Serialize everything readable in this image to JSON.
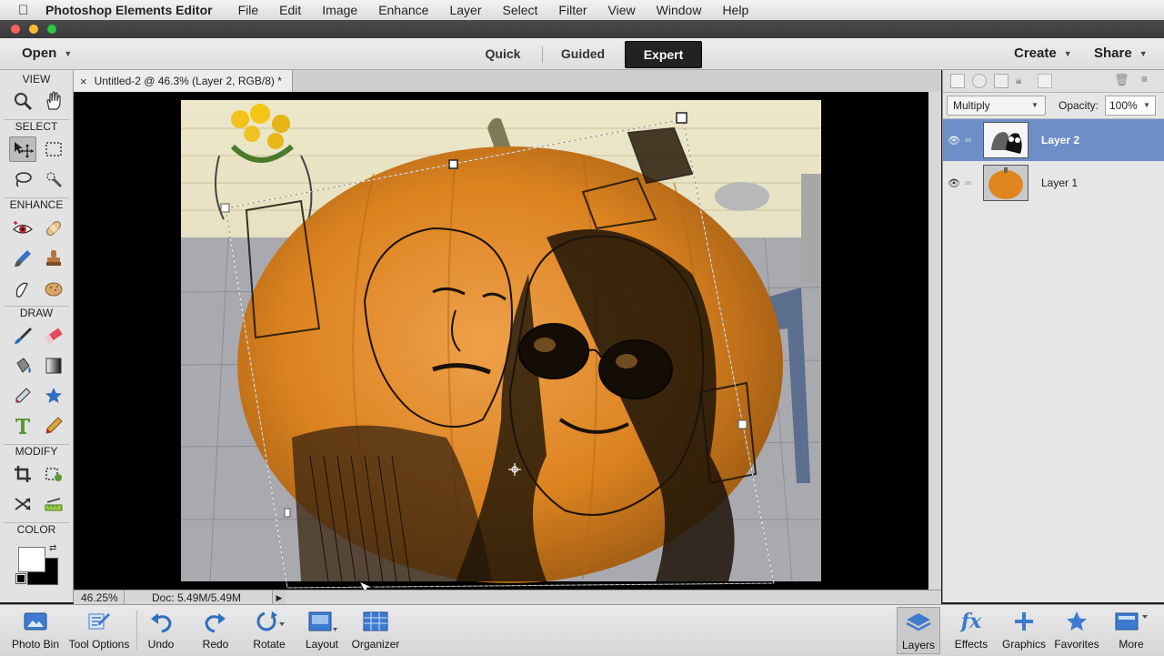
{
  "menubar": {
    "app_name": "Photoshop Elements Editor",
    "items": [
      "File",
      "Edit",
      "Image",
      "Enhance",
      "Layer",
      "Select",
      "Filter",
      "View",
      "Window",
      "Help"
    ]
  },
  "appbar": {
    "open_label": "Open",
    "modes": [
      "Quick",
      "Guided",
      "Expert"
    ],
    "active_mode": "Expert",
    "create_label": "Create",
    "share_label": "Share"
  },
  "toolbox": {
    "sections": {
      "view": "VIEW",
      "select": "SELECT",
      "enhance": "ENHANCE",
      "draw": "DRAW",
      "modify": "MODIFY",
      "color": "COLOR"
    }
  },
  "document": {
    "tab_title": "Untitled-2 @ 46.3% (Layer 2, RGB/8) *",
    "close_glyph": "×",
    "zoom": "46.25%",
    "doc_size": "Doc: 5.49M/5.49M"
  },
  "layers_panel": {
    "blend_mode": "Multiply",
    "opacity_label": "Opacity:",
    "opacity_value": "100%",
    "layers": [
      {
        "name": "Layer 2",
        "selected": true
      },
      {
        "name": "Layer 1",
        "selected": false
      }
    ]
  },
  "bottombar": {
    "left": [
      "Photo Bin",
      "Tool Options",
      "Undo",
      "Redo",
      "Rotate",
      "Layout",
      "Organizer"
    ],
    "right": [
      "Layers",
      "Effects",
      "Graphics",
      "Favorites",
      "More"
    ]
  },
  "colors": {
    "accent_selected": "#6d8ec6",
    "pumpkin": "#e0861e",
    "icon_blue": "#2f6fc0"
  }
}
